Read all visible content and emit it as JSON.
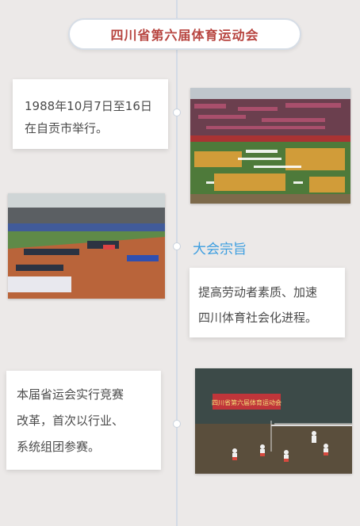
{
  "header": {
    "title": "四川省第六届体育运动会"
  },
  "event_date": {
    "line1": "1988年10月7日至16日",
    "line2": "在自贡市举行。"
  },
  "purpose": {
    "heading": "大会宗旨",
    "line1": "提高劳动者素质、加速",
    "line2": "四川体育社会化进程。"
  },
  "reform": {
    "line1": "本届省运会实行竞赛",
    "line2": "改革，首次以行业、",
    "line3": "系统组团参赛。"
  },
  "banner_text": "四川省第六届体育运动会"
}
